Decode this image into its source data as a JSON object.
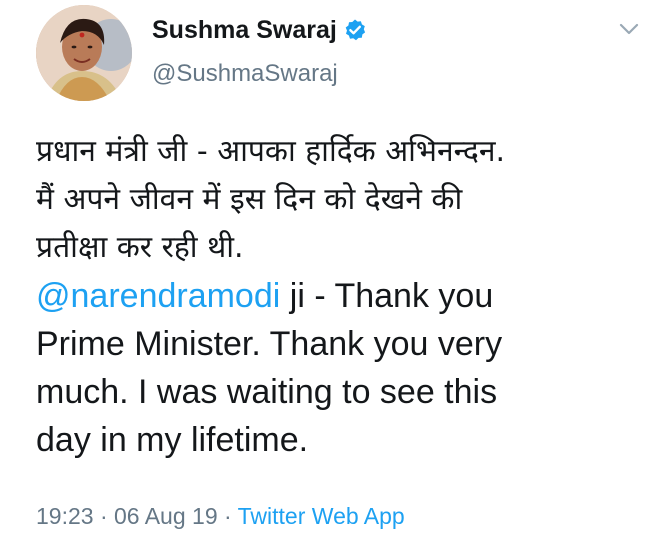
{
  "user": {
    "display_name": "Sushma Swaraj",
    "handle": "@SushmaSwaraj",
    "verified": true,
    "avatar_icon": "profile-photo"
  },
  "tweet": {
    "hindi_lines": [
      "प्रधान मंत्री जी - आपका हार्दिक अभिनन्दन.",
      "मैं अपने जीवन में इस दिन को देखने की",
      "प्रतीक्षा कर रही थी."
    ],
    "mention": "@narendramodi",
    "english_lines": [
      " ji - Thank you",
      "Prime Minister. Thank you very",
      "much. I was waiting to see this",
      "day in my lifetime."
    ]
  },
  "meta": {
    "time": "19:23",
    "separator1": " · ",
    "date": "06 Aug 19",
    "separator2": " · ",
    "source": "Twitter Web App"
  },
  "colors": {
    "accent": "#1da1f2",
    "muted": "#657786",
    "text": "#14171a"
  },
  "icons": {
    "verified": "verified-badge-icon",
    "menu": "chevron-down-icon"
  }
}
